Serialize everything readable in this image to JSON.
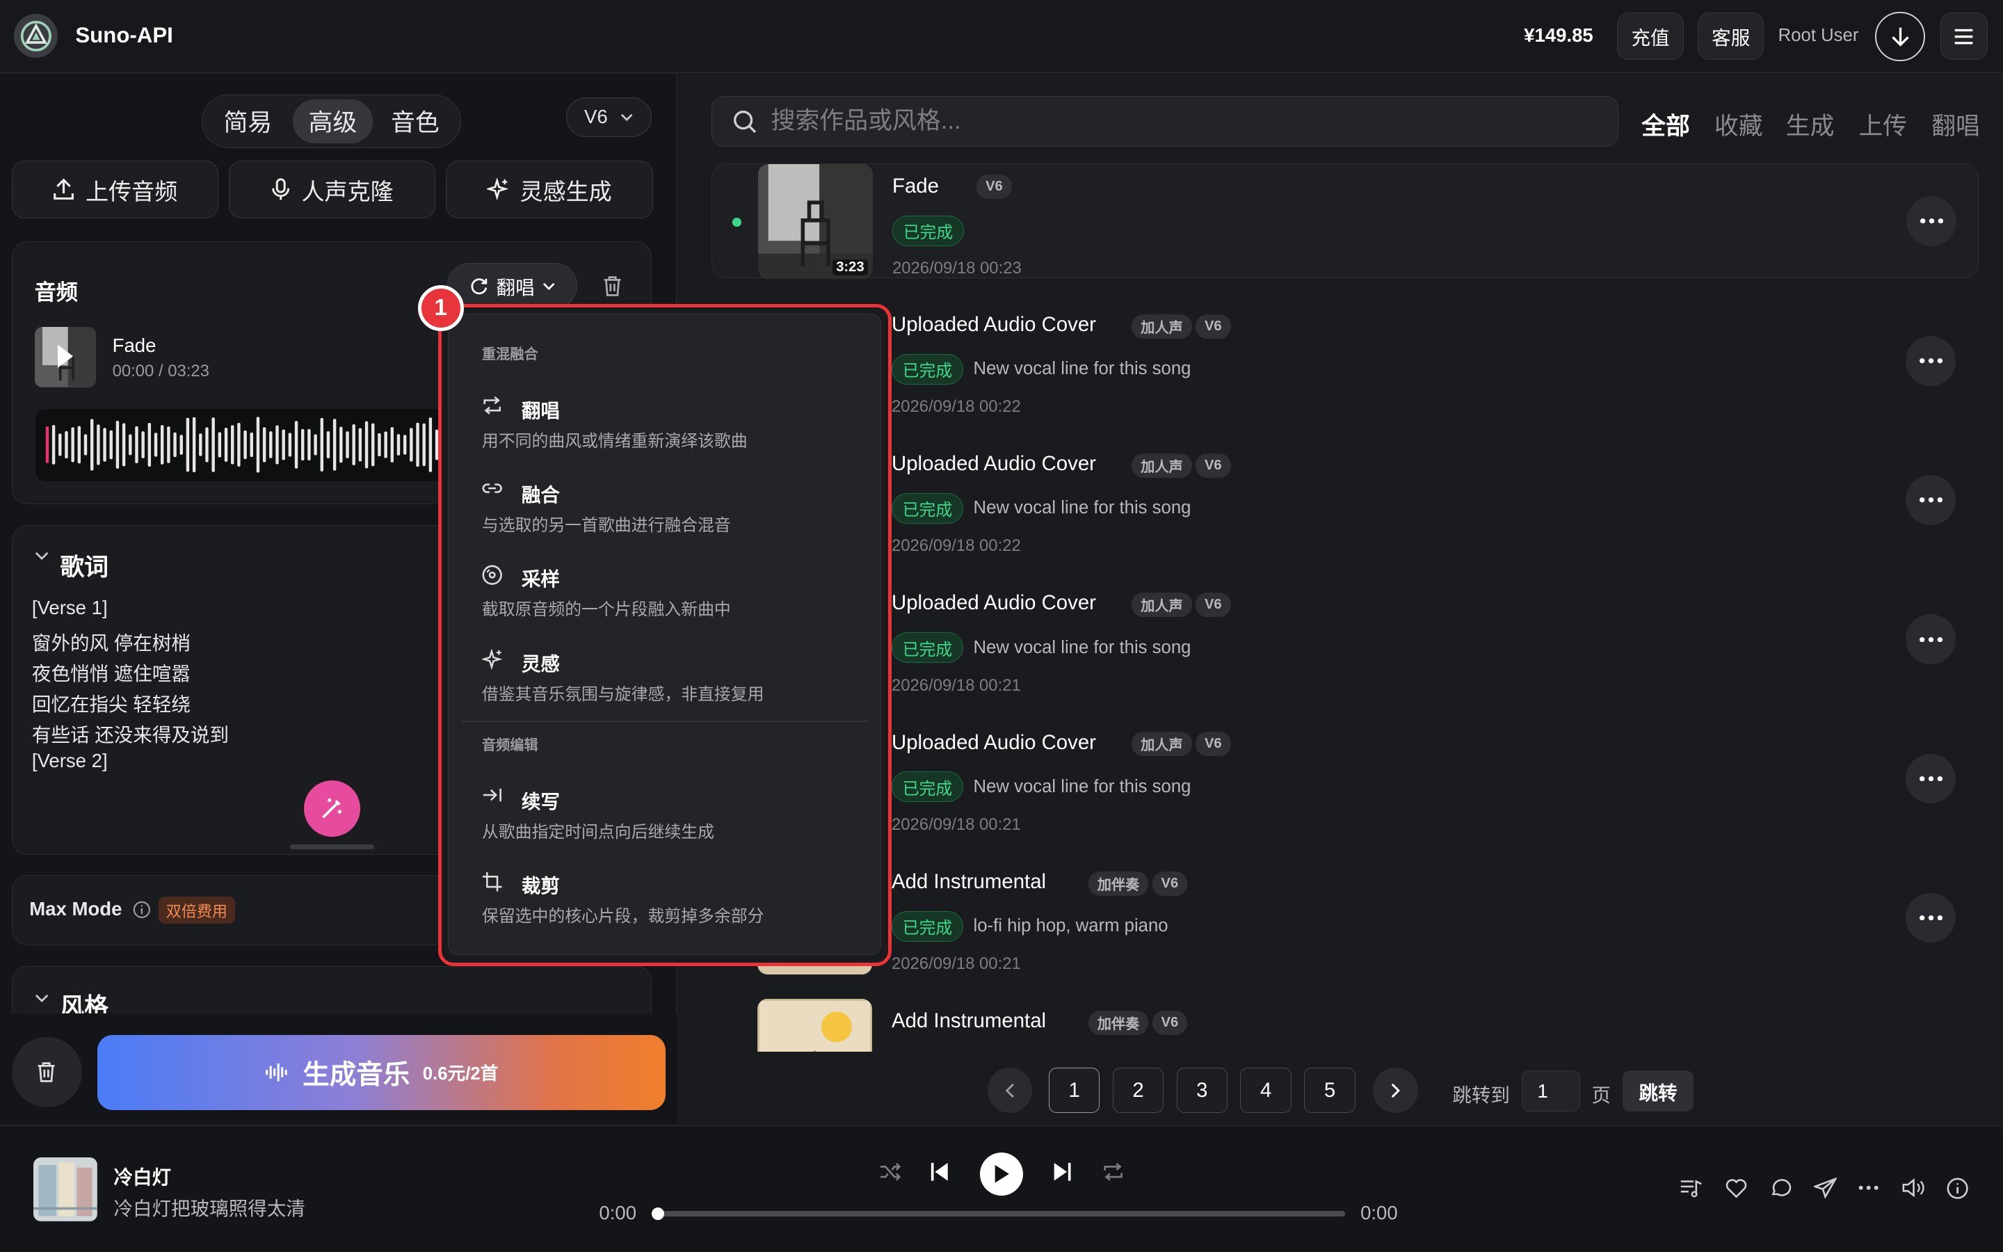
{
  "header": {
    "brand": "Suno-API",
    "balance": "¥149.85",
    "recharge": "充值",
    "support": "客服",
    "user": "Root User"
  },
  "left": {
    "modes": [
      "简易",
      "高级",
      "音色"
    ],
    "active_mode": "高级",
    "version": "V6",
    "actions": {
      "upload": "上传音频",
      "clone": "人声克隆",
      "inspire": "灵感生成"
    },
    "audio": {
      "title": "音频",
      "mode_button": "翻唱",
      "track_name": "Fade",
      "track_time": "00:00 / 03:23"
    },
    "lyrics": {
      "title": "歌词",
      "lines": [
        "[Verse 1]",
        "窗外的风 停在树梢",
        "夜色悄悄 遮住喧嚣",
        "回忆在指尖 轻轻绕",
        "有些话 还没来得及说到",
        "[Verse 2]"
      ]
    },
    "maxmode": {
      "label": "Max Mode",
      "badge": "双倍费用"
    },
    "style": {
      "title": "风格"
    },
    "generate": {
      "label": "生成音乐",
      "price": "0.6元/2首"
    }
  },
  "menu": {
    "step": "1",
    "group1": "重混融合",
    "group2": "音频编辑",
    "items": [
      {
        "label": "翻唱",
        "desc": "用不同的曲风或情绪重新演绎该歌曲",
        "icon": "repeat-icon"
      },
      {
        "label": "融合",
        "desc": "与选取的另一首歌曲进行融合混音",
        "icon": "link-icon"
      },
      {
        "label": "采样",
        "desc": "截取原音频的一个片段融入新曲中",
        "icon": "disc-icon"
      },
      {
        "label": "灵感",
        "desc": "借鉴其音乐氛围与旋律感，非直接复用",
        "icon": "sparkle-icon"
      },
      {
        "label": "续写",
        "desc": "从歌曲指定时间点向后继续生成",
        "icon": "extend-icon"
      },
      {
        "label": "裁剪",
        "desc": "保留选中的核心片段，裁剪掉多余部分",
        "icon": "crop-icon"
      }
    ]
  },
  "right": {
    "search_placeholder": "搜索作品或风格...",
    "filters": [
      "全部",
      "收藏",
      "生成",
      "上传",
      "翻唱"
    ],
    "active_filter": "全部",
    "rows": [
      {
        "title": "Fade",
        "tags": [
          "V6"
        ],
        "status": "已完成",
        "desc": "",
        "date": "2026/09/18 00:23",
        "duration": "3:23"
      },
      {
        "title": "Uploaded Audio Cover",
        "tags": [
          "加人声",
          "V6"
        ],
        "status": "已完成",
        "desc": "New vocal line for this song",
        "date": "2026/09/18 00:22"
      },
      {
        "title": "Uploaded Audio Cover",
        "tags": [
          "加人声",
          "V6"
        ],
        "status": "已完成",
        "desc": "New vocal line for this song",
        "date": "2026/09/18 00:22"
      },
      {
        "title": "Uploaded Audio Cover",
        "tags": [
          "加人声",
          "V6"
        ],
        "status": "已完成",
        "desc": "New vocal line for this song",
        "date": "2026/09/18 00:21"
      },
      {
        "title": "Uploaded Audio Cover",
        "tags": [
          "加人声",
          "V6"
        ],
        "status": "已完成",
        "desc": "New vocal line for this song",
        "date": "2026/09/18 00:21"
      },
      {
        "title": "Add Instrumental",
        "tags": [
          "加伴奏",
          "V6"
        ],
        "status": "已完成",
        "desc": "lo-fi hip hop, warm piano",
        "date": "2026/09/18 00:21"
      },
      {
        "title": "Add Instrumental",
        "tags": [
          "加伴奏",
          "V6"
        ],
        "status": "",
        "desc": "",
        "date": ""
      }
    ],
    "pagination": {
      "pages": [
        "1",
        "2",
        "3",
        "4",
        "5"
      ],
      "current": "1",
      "jump_label": "跳转到",
      "jump_value": "1",
      "page_unit": "页",
      "jump_button": "跳转"
    }
  },
  "player": {
    "title": "冷白灯",
    "subtitle": "冷白灯把玻璃照得太清",
    "time_current": "0:00",
    "time_total": "0:00",
    "progress": 0
  },
  "colors": {
    "accent": "#ea3237",
    "success": "#3ed88a",
    "pink": "#e64b9d"
  }
}
